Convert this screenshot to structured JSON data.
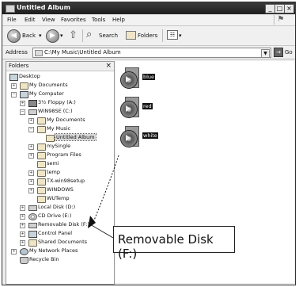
{
  "window": {
    "title": "Untitled Album",
    "controls": {
      "minimize": "_",
      "maximize": "□",
      "close": "×"
    }
  },
  "menu": {
    "items": [
      "File",
      "Edit",
      "View",
      "Favorites",
      "Tools",
      "Help"
    ]
  },
  "toolbar": {
    "back_label": "Back",
    "search_label": "Search",
    "folders_label": "Folders"
  },
  "address": {
    "label": "Address",
    "value": "C:\\My Music\\Untitled Album",
    "go_label": "Go"
  },
  "folders_pane": {
    "title": "Folders",
    "close": "×",
    "tree": [
      {
        "label": "Desktop"
      },
      {
        "label": "My Documents"
      },
      {
        "label": "My Computer"
      },
      {
        "label": "3½ Floppy (A:)"
      },
      {
        "label": "WIN98SE (C:)"
      },
      {
        "label": "My Documents"
      },
      {
        "label": "My Music"
      },
      {
        "label": "Untitled Album"
      },
      {
        "label": "mySingle"
      },
      {
        "label": "Program Files"
      },
      {
        "label": "semi"
      },
      {
        "label": "temp"
      },
      {
        "label": "TX-win98setup"
      },
      {
        "label": "WINDOWS"
      },
      {
        "label": "WUTemp"
      },
      {
        "label": "Local Disk (D:)"
      },
      {
        "label": "CD Drive (E:)"
      },
      {
        "label": "Removable Disk (F:)"
      },
      {
        "label": "Control Panel"
      },
      {
        "label": "Shared Documents"
      },
      {
        "label": "My Network Places"
      },
      {
        "label": "Recycle Bin"
      }
    ]
  },
  "files": [
    {
      "name": "blue"
    },
    {
      "name": "red"
    },
    {
      "name": "white"
    }
  ],
  "callout": {
    "text": "Removable Disk (F:)"
  }
}
